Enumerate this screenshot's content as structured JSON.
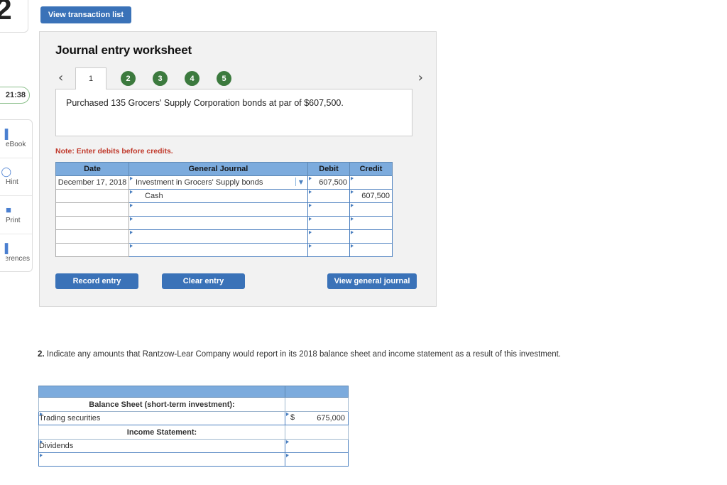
{
  "sidebar": {
    "question_number": "2",
    "timer": "21:38",
    "tools": [
      {
        "icon": "ebook-icon",
        "glyph": "▌",
        "label": "eBook"
      },
      {
        "icon": "hint-icon",
        "glyph": "◯",
        "label": "Hint"
      },
      {
        "icon": "print-icon",
        "glyph": "■",
        "label": "Print"
      },
      {
        "icon": "references-icon",
        "glyph": "▌",
        "label": "References"
      }
    ]
  },
  "toolbar": {
    "view_transaction_list": "View transaction list"
  },
  "worksheet": {
    "title": "Journal entry worksheet",
    "prev_arrow": "‹",
    "next_arrow": "›",
    "tabs": [
      {
        "label": "1",
        "state": "active"
      },
      {
        "label": "2",
        "state": "complete"
      },
      {
        "label": "3",
        "state": "complete"
      },
      {
        "label": "4",
        "state": "complete"
      },
      {
        "label": "5",
        "state": "complete"
      }
    ],
    "transaction_text": "Purchased 135 Grocers' Supply Corporation bonds at par of $607,500.",
    "note": "Note: Enter debits before credits.",
    "table": {
      "headers": [
        "Date",
        "General Journal",
        "Debit",
        "Credit"
      ],
      "rows": [
        {
          "date": "December 17, 2018",
          "account": "Investment in Grocers' Supply bonds",
          "indent": false,
          "has_dropdown": true,
          "debit": "607,500",
          "credit": ""
        },
        {
          "date": "",
          "account": "Cash",
          "indent": true,
          "has_dropdown": false,
          "debit": "",
          "credit": "607,500"
        },
        {
          "date": "",
          "account": "",
          "indent": false,
          "has_dropdown": false,
          "debit": "",
          "credit": ""
        },
        {
          "date": "",
          "account": "",
          "indent": false,
          "has_dropdown": false,
          "debit": "",
          "credit": ""
        },
        {
          "date": "",
          "account": "",
          "indent": false,
          "has_dropdown": false,
          "debit": "",
          "credit": ""
        },
        {
          "date": "",
          "account": "",
          "indent": false,
          "has_dropdown": false,
          "debit": "",
          "credit": ""
        }
      ]
    },
    "buttons": {
      "record_entry": "Record entry",
      "clear_entry": "Clear entry",
      "view_general_journal": "View general journal"
    }
  },
  "question2": {
    "number": "2.",
    "text": "Indicate any amounts that Rantzow-Lear Company would report in its 2018 balance sheet and income statement as a result of this investment.",
    "table": {
      "rows": [
        {
          "type": "header",
          "label": "",
          "currency": "",
          "value": ""
        },
        {
          "type": "section",
          "label": "Balance Sheet (short-term investment):",
          "currency": "",
          "value": ""
        },
        {
          "type": "entry",
          "label": "Trading securities",
          "currency": "$",
          "value": "675,000"
        },
        {
          "type": "section",
          "label": "Income Statement:",
          "currency": "",
          "value": ""
        },
        {
          "type": "entry",
          "label": "Dividends",
          "currency": "",
          "value": ""
        },
        {
          "type": "entry",
          "label": "",
          "currency": "",
          "value": ""
        }
      ]
    }
  },
  "colors": {
    "button_blue": "#3a72b8",
    "table_header_blue": "#7cabdd",
    "tab_green": "#3c7a3e",
    "note_red": "#c0392b",
    "panel_gray": "#f2f2f2"
  }
}
